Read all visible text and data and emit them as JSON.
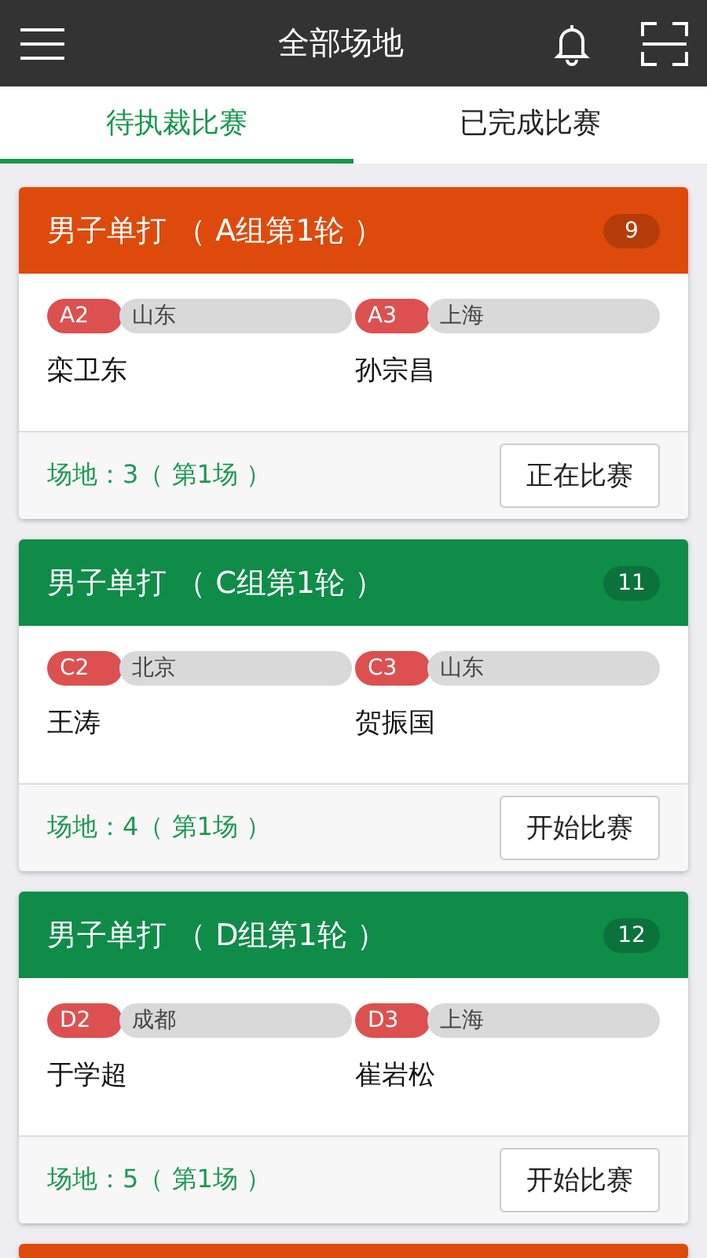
{
  "app_bar": {
    "title": "全部场地"
  },
  "tabs": [
    {
      "label": "待执裁比赛",
      "selected": true
    },
    {
      "label": "已完成比赛",
      "selected": false
    }
  ],
  "matches": [
    {
      "title": "男子单打 （ A组第1轮 ）",
      "count": "9",
      "color": "#dd4a0c",
      "players": [
        {
          "seed": "A2",
          "region": "山东",
          "name": "栾卫东"
        },
        {
          "seed": "A3",
          "region": "上海",
          "name": "孙宗昌"
        }
      ],
      "venue": "场地：3（ 第1场 ）",
      "action": "正在比赛"
    },
    {
      "title": "男子单打 （ C组第1轮 ）",
      "count": "11",
      "color": "#0e8c48",
      "players": [
        {
          "seed": "C2",
          "region": "北京",
          "name": "王涛"
        },
        {
          "seed": "C3",
          "region": "山东",
          "name": "贺振国"
        }
      ],
      "venue": "场地：4（ 第1场 ）",
      "action": "开始比赛"
    },
    {
      "title": "男子单打 （ D组第1轮 ）",
      "count": "12",
      "color": "#0e8c48",
      "players": [
        {
          "seed": "D2",
          "region": "成都",
          "name": "于学超"
        },
        {
          "seed": "D3",
          "region": "上海",
          "name": "崔岩松"
        }
      ],
      "venue": "场地：5（ 第1场 ）",
      "action": "开始比赛"
    },
    {
      "color": "#dd4a0c"
    }
  ]
}
